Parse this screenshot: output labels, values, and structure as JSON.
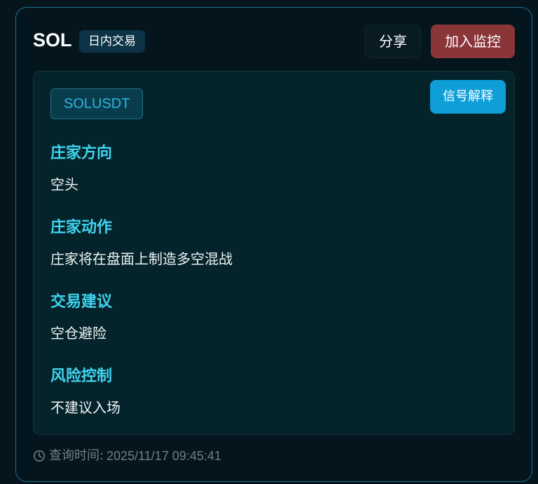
{
  "header": {
    "coin": "SOL",
    "mode_badge": "日内交易",
    "share_label": "分享",
    "watch_label": "加入监控"
  },
  "panel": {
    "symbol": "SOLUSDT",
    "explain_label": "信号解释",
    "sections": [
      {
        "title": "庄家方向",
        "value": "空头"
      },
      {
        "title": "庄家动作",
        "value": "庄家将在盘面上制造多空混战"
      },
      {
        "title": "交易建议",
        "value": "空仓避险"
      },
      {
        "title": "风险控制",
        "value": "不建议入场"
      }
    ]
  },
  "footer": {
    "icon": "clock-icon",
    "query_label": "查询时间:",
    "query_time": "2025/11/17 09:45:41"
  },
  "colors": {
    "accent": "#3fd4ef",
    "watch_button": "#8a3538",
    "explain_button": "#0e9fd9",
    "symbol_tag": "#2db3e0"
  }
}
